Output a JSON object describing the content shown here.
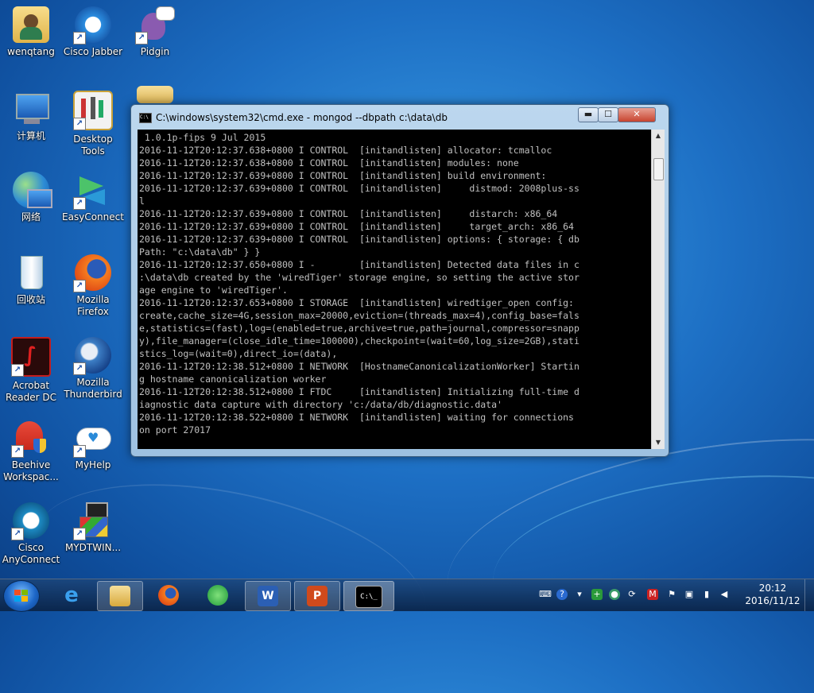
{
  "desktop": {
    "icons": [
      {
        "label": "wenqtang"
      },
      {
        "label": "Cisco Jabber"
      },
      {
        "label": "Pidgin"
      },
      {
        "label": "计算机"
      },
      {
        "label": "Desktop Tools"
      },
      {
        "label": "网络"
      },
      {
        "label": "EasyConnect"
      },
      {
        "label": "回收站"
      },
      {
        "label": "Mozilla Firefox"
      },
      {
        "label": "Acrobat Reader DC"
      },
      {
        "label": "Mozilla Thunderbird"
      },
      {
        "label": "Beehive Workspac..."
      },
      {
        "label": "MyHelp"
      },
      {
        "label": "Cisco AnyConnect"
      },
      {
        "label": "MYDTWIN..."
      }
    ]
  },
  "window": {
    "title": "C:\\windows\\system32\\cmd.exe - mongod  --dbpath c:\\data\\db",
    "minimize_label": "▬",
    "maximize_label": "☐",
    "close_label": "✕",
    "console_text": " 1.0.1p-fips 9 Jul 2015\n2016-11-12T20:12:37.638+0800 I CONTROL  [initandlisten] allocator: tcmalloc\n2016-11-12T20:12:37.638+0800 I CONTROL  [initandlisten] modules: none\n2016-11-12T20:12:37.639+0800 I CONTROL  [initandlisten] build environment:\n2016-11-12T20:12:37.639+0800 I CONTROL  [initandlisten]     distmod: 2008plus-ss\nl\n2016-11-12T20:12:37.639+0800 I CONTROL  [initandlisten]     distarch: x86_64\n2016-11-12T20:12:37.639+0800 I CONTROL  [initandlisten]     target_arch: x86_64\n2016-11-12T20:12:37.639+0800 I CONTROL  [initandlisten] options: { storage: { db\nPath: \"c:\\data\\db\" } }\n2016-11-12T20:12:37.650+0800 I -        [initandlisten] Detected data files in c\n:\\data\\db created by the 'wiredTiger' storage engine, so setting the active stor\nage engine to 'wiredTiger'.\n2016-11-12T20:12:37.653+0800 I STORAGE  [initandlisten] wiredtiger_open config:\ncreate,cache_size=4G,session_max=20000,eviction=(threads_max=4),config_base=fals\ne,statistics=(fast),log=(enabled=true,archive=true,path=journal,compressor=snapp\ny),file_manager=(close_idle_time=100000),checkpoint=(wait=60,log_size=2GB),stati\nstics_log=(wait=0),direct_io=(data),\n2016-11-12T20:12:38.512+0800 I NETWORK  [HostnameCanonicalizationWorker] Startin\ng hostname canonicalization worker\n2016-11-12T20:12:38.512+0800 I FTDC     [initandlisten] Initializing full-time d\niagnostic data capture with directory 'c:/data/db/diagnostic.data'\n2016-11-12T20:12:38.522+0800 I NETWORK  [initandlisten] waiting for connections\non port 27017"
  },
  "taskbar": {
    "buttons": [
      {
        "icon": "internet-explorer-icon"
      },
      {
        "icon": "file-explorer-icon"
      },
      {
        "icon": "firefox-icon"
      },
      {
        "icon": "easyconnect-icon"
      },
      {
        "icon": "word-icon",
        "glyph": "W"
      },
      {
        "icon": "powerpoint-icon",
        "glyph": "P"
      },
      {
        "icon": "cmd-icon",
        "glyph": "C:\\_"
      }
    ],
    "clock_time": "20:12",
    "clock_date": "2016/11/12"
  }
}
